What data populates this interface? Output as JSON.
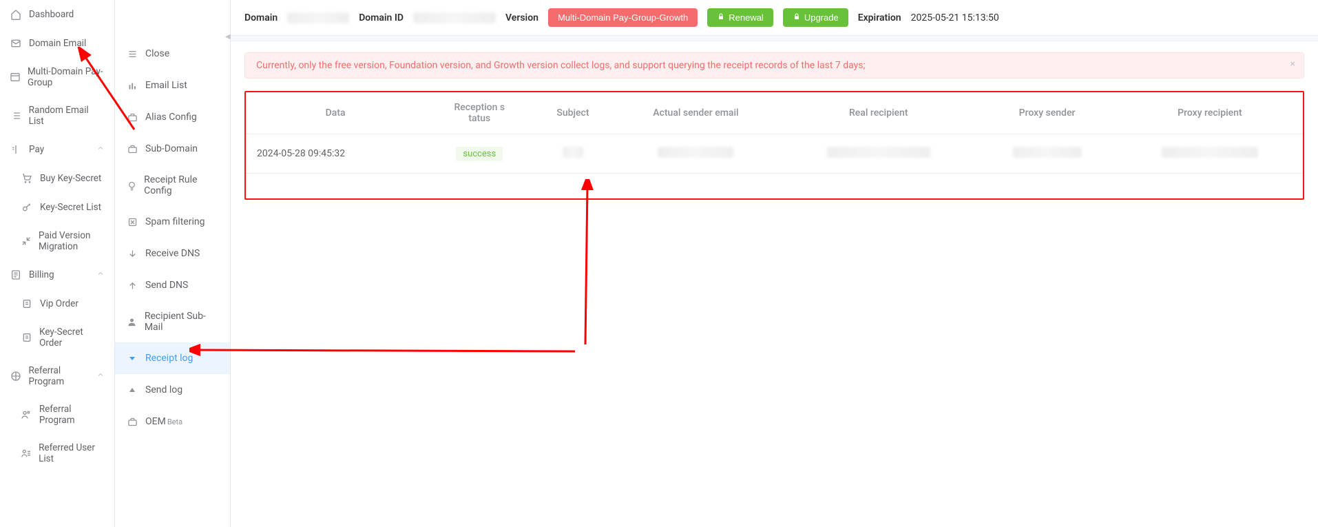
{
  "topbar": {
    "domain_label": "Domain",
    "domainid_label": "Domain ID",
    "version_label": "Version",
    "version_tag": "Multi-Domain Pay-Group-Growth",
    "renewal_label": "Renewal",
    "upgrade_label": "Upgrade",
    "expiration_label": "Expiration",
    "expiration_value": "2025-05-21 15:13:50"
  },
  "sidebar": {
    "items": [
      {
        "label": "Dashboard"
      },
      {
        "label": "Domain Email"
      },
      {
        "label": "Multi-Domain Pay-Group"
      },
      {
        "label": "Random Email List"
      },
      {
        "label": "Pay"
      },
      {
        "label": "Buy Key-Secret"
      },
      {
        "label": "Key-Secret List"
      },
      {
        "label": "Paid Version Migration"
      },
      {
        "label": "Billing"
      },
      {
        "label": "Vip Order"
      },
      {
        "label": "Key-Secret Order"
      },
      {
        "label": "Referral Program"
      },
      {
        "label": "Referral Program"
      },
      {
        "label": "Referred User List"
      }
    ]
  },
  "subnav": {
    "close": "Close",
    "items": [
      {
        "label": "Email List"
      },
      {
        "label": "Alias Config"
      },
      {
        "label": "Sub-Domain"
      },
      {
        "label": "Receipt Rule Config"
      },
      {
        "label": "Spam filtering"
      },
      {
        "label": "Receive DNS"
      },
      {
        "label": "Send DNS"
      },
      {
        "label": "Recipient Sub-Mail"
      },
      {
        "label": "Receipt log"
      },
      {
        "label": "Send log"
      },
      {
        "label": "OEM"
      }
    ],
    "oem_beta": "Beta"
  },
  "alert": {
    "text": "Currently, only the free version, Foundation version, and Growth version collect logs, and support querying the receipt records of the last 7 days;"
  },
  "table": {
    "headers": [
      "Data",
      "Reception s\ntatus",
      "Subject",
      "Actual sender email",
      "Real recipient",
      "Proxy sender",
      "Proxy recipient"
    ],
    "rows": [
      {
        "data": "2024-05-28 09:45:32",
        "status": "success"
      }
    ]
  }
}
